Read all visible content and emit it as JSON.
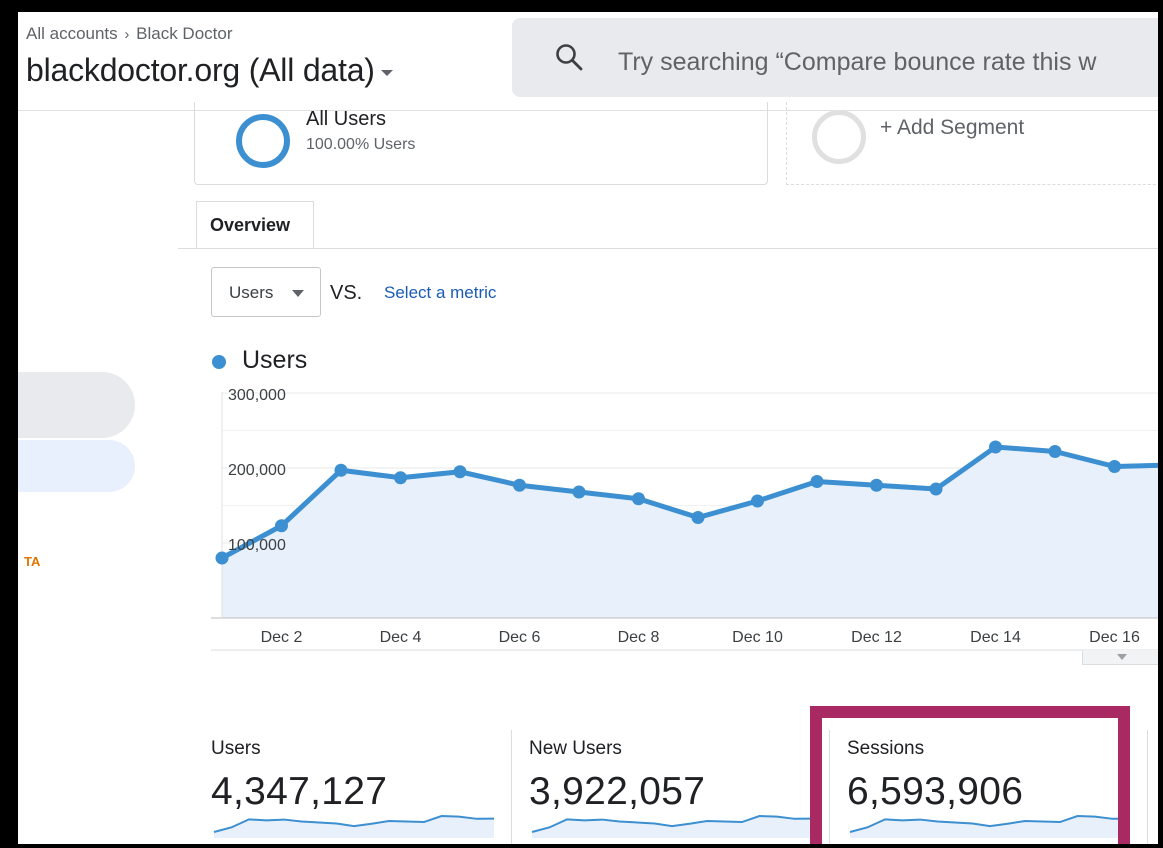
{
  "header": {
    "breadcrumb_root": "All accounts",
    "breadcrumb_sep": "›",
    "breadcrumb_account": "Black Doctor",
    "property_name": "blackdoctor.org (All data)",
    "search_placeholder": "Try searching “Compare bounce rate this w"
  },
  "sidebar": {
    "beta_label": "TA"
  },
  "segments": {
    "active_name": "All Users",
    "active_sub": "100.00% Users",
    "add_label": "+ Add Segment"
  },
  "tabs": [
    {
      "label": "Overview",
      "active": true
    }
  ],
  "metric_picker": {
    "selected": "Users",
    "vs_label": "VS.",
    "select_metric_link": "Select a metric"
  },
  "chart_data": {
    "type": "area",
    "series": [
      {
        "name": "Users",
        "color": "#3c8fd0",
        "x": [
          "Dec 1",
          "Dec 2",
          "Dec 3",
          "Dec 4",
          "Dec 5",
          "Dec 6",
          "Dec 7",
          "Dec 8",
          "Dec 9",
          "Dec 10",
          "Dec 11",
          "Dec 12",
          "Dec 13",
          "Dec 14",
          "Dec 15",
          "Dec 16",
          "Dec 17"
        ],
        "values": [
          80000,
          123000,
          197000,
          187000,
          195000,
          177000,
          168000,
          159000,
          134000,
          156000,
          182000,
          177000,
          172000,
          228000,
          222000,
          202000,
          204000
        ]
      }
    ],
    "x_tick_labels": [
      "Dec 2",
      "Dec 4",
      "Dec 6",
      "Dec 8",
      "Dec 10",
      "Dec 12",
      "Dec 14",
      "Dec 16"
    ],
    "y_tick_labels": [
      "100,000",
      "200,000",
      "300,000"
    ],
    "y_ticks": [
      100000,
      200000,
      300000
    ],
    "ylim": [
      0,
      300000
    ],
    "legend": "top-left",
    "fill_color": "#e8f0fb",
    "grid": true
  },
  "scorecards": [
    {
      "label": "Users",
      "value": "4,347,127"
    },
    {
      "label": "New Users",
      "value": "3,922,057"
    },
    {
      "label": "Sessions",
      "value": "6,593,906",
      "highlighted": true
    }
  ],
  "colors": {
    "accent": "#3c8fd0",
    "highlight": "#a92a63",
    "link": "#1a5bb8"
  }
}
